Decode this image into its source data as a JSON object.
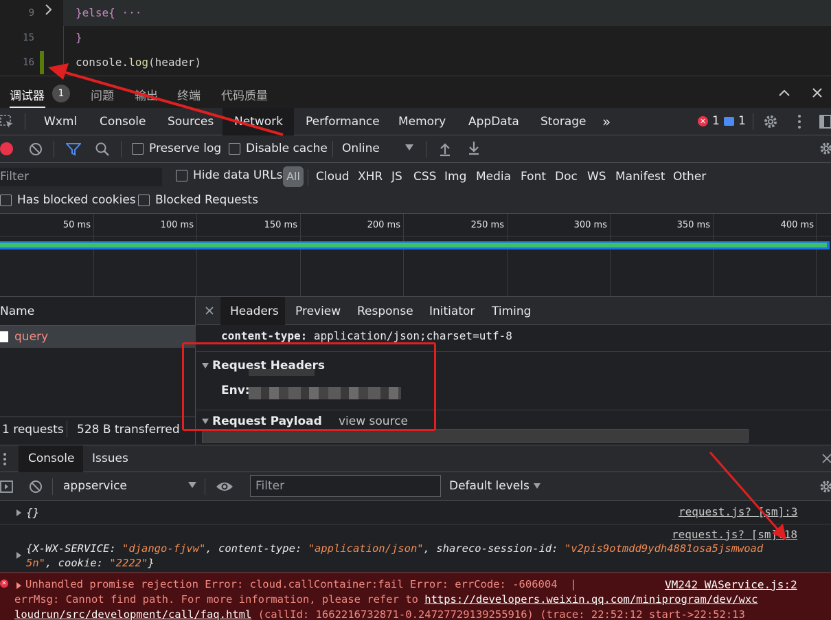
{
  "editor": {
    "lines": [
      {
        "num": "9",
        "text": "}else{ ···"
      },
      {
        "num": "15",
        "text": "}"
      },
      {
        "num": "16",
        "text_plain": "console.",
        "text_fn": "log",
        "text_rest": "(header)"
      }
    ]
  },
  "panel_tabs": {
    "items": [
      "调试器",
      "问题",
      "输出",
      "终端",
      "代码质量"
    ],
    "debugger_badge": "1"
  },
  "devtools": {
    "main_tabs": [
      "Wxml",
      "Console",
      "Sources",
      "Network",
      "Performance",
      "Memory",
      "AppData",
      "Storage"
    ],
    "active_tab": "Network",
    "more": "»",
    "error_count": "1",
    "message_count": "1"
  },
  "network": {
    "preserve_log": "Preserve log",
    "disable_cache": "Disable cache",
    "throttling": "Online",
    "filter_placeholder": "Filter",
    "hide_data_urls": "Hide data URLs",
    "type_filters": [
      "All",
      "Cloud",
      "XHR",
      "JS",
      "CSS",
      "Img",
      "Media",
      "Font",
      "Doc",
      "WS",
      "Manifest",
      "Other"
    ],
    "has_blocked_cookies": "Has blocked cookies",
    "blocked_requests": "Blocked Requests",
    "timeline_ticks": [
      "50 ms",
      "100 ms",
      "150 ms",
      "200 ms",
      "250 ms",
      "300 ms",
      "350 ms",
      "400 ms"
    ],
    "name_header": "Name",
    "requests": [
      {
        "name": "query"
      }
    ],
    "summary_requests": "1 requests",
    "summary_transferred": "528 B transferred"
  },
  "detail": {
    "tabs": [
      "Headers",
      "Preview",
      "Response",
      "Initiator",
      "Timing"
    ],
    "active_tab": "Headers",
    "content_type_key": "content-type:",
    "content_type_val": "application/json;charset=utf-8",
    "request_headers": "Request Headers",
    "env_key": "Env:",
    "request_payload": "Request Payload",
    "view_source": "view source"
  },
  "console": {
    "tabs": [
      "Console",
      "Issues"
    ],
    "context": "appservice",
    "filter_placeholder": "Filter",
    "levels": "Default levels",
    "messages": [
      {
        "text": "{}",
        "source": "request.js? [sm]:3"
      },
      {
        "source": "request.js? [sm]:18",
        "obj_k1": "X-WX-SERVICE: ",
        "obj_v1": "\"django-fjvw\"",
        "obj_k2": ", content-type: ",
        "obj_v2": "\"application/json\"",
        "obj_k3": ", shareco-session-id: ",
        "obj_v3a": "\"v2pis9otmdd9ydh4881osa5jsmwoad",
        "obj_v3b": "5n\"",
        "obj_k4": ", cookie: ",
        "obj_v4": "\"2222\""
      },
      {
        "source": "VM242 WAService.js:2",
        "line1": "Unhandled promise rejection Error: cloud.callContainer:fail Error: errCode: -606004  |",
        "line2a": "errMsg: Cannot find path. For more information, please refer to ",
        "link": "https://developers.weixin.qq.com/miniprogram/dev/wxc",
        "line3link": "loudrun/src/development/call/faq.html",
        "line3b": " (callId: 1662216732871-0.24727729139255916) (trace: 22:52:12 start->22:52:13"
      }
    ]
  },
  "colors": {
    "accent_red": "#e02020",
    "error_bg": "#4a0f12",
    "string_orange": "#f28b54"
  }
}
